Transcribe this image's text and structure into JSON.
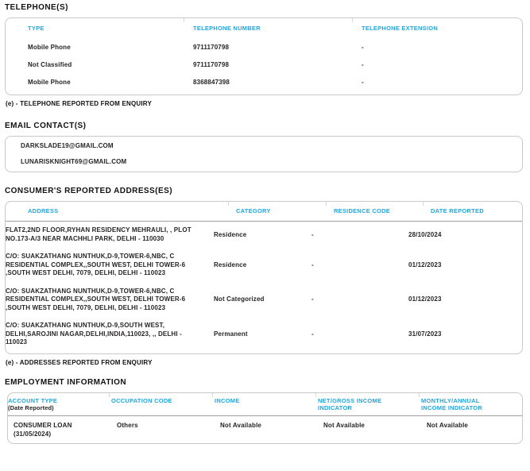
{
  "colors": {
    "accent": "#1FA7DC",
    "text": "#262424",
    "title": "#111111",
    "border": "#C9C9C9",
    "divider": "#9D9D9D",
    "tick": "#D8D8D8"
  },
  "telephones": {
    "title": "TELEPHONE(S)",
    "columns": [
      "TYPE",
      "TELEPHONE NUMBER",
      "TELEPHONE EXTENSION"
    ],
    "rows": [
      {
        "type": "Mobile Phone",
        "number": "9711170798",
        "extension": "-"
      },
      {
        "type": "Not Classified",
        "number": "9711170798",
        "extension": "-"
      },
      {
        "type": "Mobile Phone",
        "number": "8368847398",
        "extension": "-"
      }
    ],
    "footnote": "(e) - TELEPHONE REPORTED FROM ENQUIRY"
  },
  "emails": {
    "title": "EMAIL CONTACT(S)",
    "items": [
      "DARKSLADE19@GMAIL.COM",
      "LUNARISKNIGHT69@GMAIL.COM"
    ]
  },
  "addresses": {
    "title": "CONSUMER'S REPORTED ADDRESS(ES)",
    "columns": [
      "ADDRESS",
      "CATEGORY",
      "RESIDENCE CODE",
      "DATE REPORTED"
    ],
    "rows": [
      {
        "address": "FLAT2,2ND FLOOR,RYHAN RESIDENCY MEHRAULI, , PLOT NO.173-A/3 NEAR MACHHLI PARK, DELHI - 110030",
        "category": "Residence",
        "residence_code": "-",
        "date_reported": "28/10/2024"
      },
      {
        "address": "C/O: SUAKZATHANG NUNTHUK,D-9,TOWER-6,NBC, C RESIDENTIAL COMPLEX,,SOUTH WEST, DELHI TOWER-6 ,SOUTH WEST DELHI, 7079, DELHI, DELHI - 110023",
        "category": "Residence",
        "residence_code": "-",
        "date_reported": "01/12/2023"
      },
      {
        "address": "C/O: SUAKZATHANG NUNTHUK,D-9,TOWER-6,NBC, C RESIDENTIAL COMPLEX,,SOUTH WEST, DELHI TOWER-6 ,SOUTH WEST DELHI, 7079, DELHI, DELHI - 110023",
        "category": "Not Categorized",
        "residence_code": "-",
        "date_reported": "01/12/2023"
      },
      {
        "address": "C/O: SUAKZATHANG NUNTHUK,D-9,SOUTH WEST, DELHI,SAROJINI NAGAR,DELHI,INDIA,110023, ,, DELHI - 110023",
        "category": "Permanent",
        "residence_code": "-",
        "date_reported": "31/07/2023"
      }
    ],
    "footnote": "(e) - ADDRESSES REPORTED FROM ENQUIRY"
  },
  "employment": {
    "title": "EMPLOYMENT INFORMATION",
    "columns": [
      {
        "label": "ACCOUNT TYPE",
        "sub": "(Date Reported)"
      },
      {
        "label": "OCCUPATION CODE"
      },
      {
        "label": "INCOME"
      },
      {
        "label": "NET/GROSS INCOME INDICATOR"
      },
      {
        "label": "MONTHLY/ANNUAL INCOME INDICATOR"
      }
    ],
    "rows": [
      {
        "account_type": "CONSUMER LOAN",
        "date_reported": "(31/05/2024)",
        "occupation_code": "Others",
        "income": "Not Available",
        "net_gross": "Not Available",
        "monthly_annual": "Not Available"
      }
    ]
  }
}
